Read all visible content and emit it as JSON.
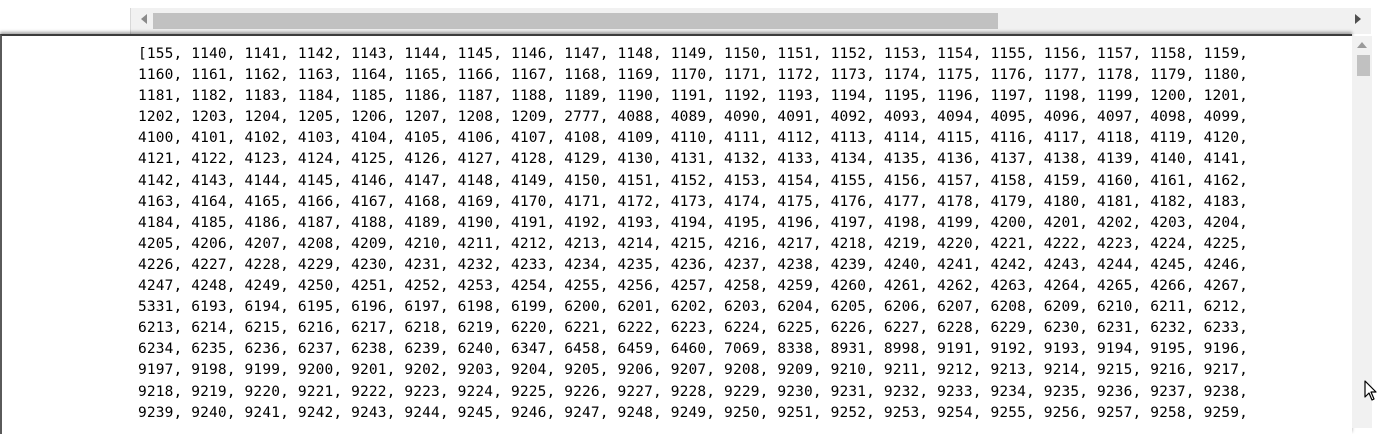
{
  "horizontal_scrollbar": {
    "left_arrow": "triangle-left",
    "right_arrow": "triangle-right"
  },
  "vertical_scrollbar": {
    "up_arrow": "triangle-up"
  },
  "output_lines": [
    "[155, 1140, 1141, 1142, 1143, 1144, 1145, 1146, 1147, 1148, 1149, 1150, 1151, 1152, 1153, 1154, 1155, 1156, 1157, 1158, 1159,",
    "1160, 1161, 1162, 1163, 1164, 1165, 1166, 1167, 1168, 1169, 1170, 1171, 1172, 1173, 1174, 1175, 1176, 1177, 1178, 1179, 1180,",
    "1181, 1182, 1183, 1184, 1185, 1186, 1187, 1188, 1189, 1190, 1191, 1192, 1193, 1194, 1195, 1196, 1197, 1198, 1199, 1200, 1201,",
    "1202, 1203, 1204, 1205, 1206, 1207, 1208, 1209, 2777, 4088, 4089, 4090, 4091, 4092, 4093, 4094, 4095, 4096, 4097, 4098, 4099,",
    "4100, 4101, 4102, 4103, 4104, 4105, 4106, 4107, 4108, 4109, 4110, 4111, 4112, 4113, 4114, 4115, 4116, 4117, 4118, 4119, 4120,",
    "4121, 4122, 4123, 4124, 4125, 4126, 4127, 4128, 4129, 4130, 4131, 4132, 4133, 4134, 4135, 4136, 4137, 4138, 4139, 4140, 4141,",
    "4142, 4143, 4144, 4145, 4146, 4147, 4148, 4149, 4150, 4151, 4152, 4153, 4154, 4155, 4156, 4157, 4158, 4159, 4160, 4161, 4162,",
    "4163, 4164, 4165, 4166, 4167, 4168, 4169, 4170, 4171, 4172, 4173, 4174, 4175, 4176, 4177, 4178, 4179, 4180, 4181, 4182, 4183,",
    "4184, 4185, 4186, 4187, 4188, 4189, 4190, 4191, 4192, 4193, 4194, 4195, 4196, 4197, 4198, 4199, 4200, 4201, 4202, 4203, 4204,",
    "4205, 4206, 4207, 4208, 4209, 4210, 4211, 4212, 4213, 4214, 4215, 4216, 4217, 4218, 4219, 4220, 4221, 4222, 4223, 4224, 4225,",
    "4226, 4227, 4228, 4229, 4230, 4231, 4232, 4233, 4234, 4235, 4236, 4237, 4238, 4239, 4240, 4241, 4242, 4243, 4244, 4245, 4246,",
    "4247, 4248, 4249, 4250, 4251, 4252, 4253, 4254, 4255, 4256, 4257, 4258, 4259, 4260, 4261, 4262, 4263, 4264, 4265, 4266, 4267,",
    "5331, 6193, 6194, 6195, 6196, 6197, 6198, 6199, 6200, 6201, 6202, 6203, 6204, 6205, 6206, 6207, 6208, 6209, 6210, 6211, 6212,",
    "6213, 6214, 6215, 6216, 6217, 6218, 6219, 6220, 6221, 6222, 6223, 6224, 6225, 6226, 6227, 6228, 6229, 6230, 6231, 6232, 6233,",
    "6234, 6235, 6236, 6237, 6238, 6239, 6240, 6347, 6458, 6459, 6460, 7069, 8338, 8931, 8998, 9191, 9192, 9193, 9194, 9195, 9196,",
    "9197, 9198, 9199, 9200, 9201, 9202, 9203, 9204, 9205, 9206, 9207, 9208, 9209, 9210, 9211, 9212, 9213, 9214, 9215, 9216, 9217,",
    "9218, 9219, 9220, 9221, 9222, 9223, 9224, 9225, 9226, 9227, 9228, 9229, 9230, 9231, 9232, 9233, 9234, 9235, 9236, 9237, 9238,",
    "9239, 9240, 9241, 9242, 9243, 9244, 9245, 9246, 9247, 9248, 9249, 9250, 9251, 9252, 9253, 9254, 9255, 9256, 9257, 9258, 9259,"
  ]
}
